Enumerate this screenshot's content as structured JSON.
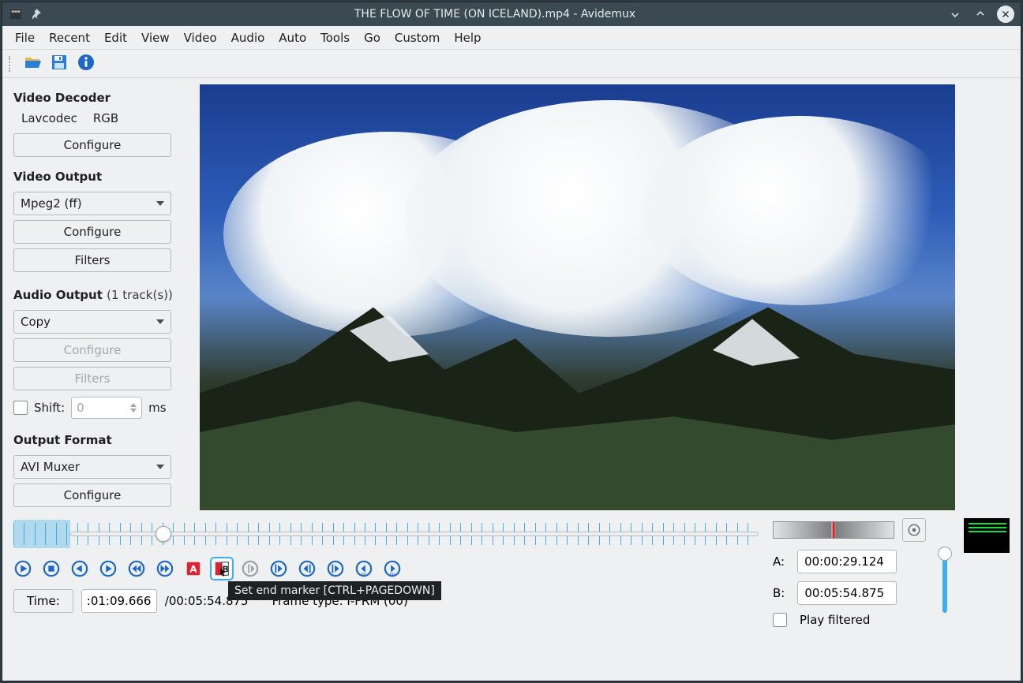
{
  "window": {
    "title": "THE FLOW OF TIME (ON ICELAND).mp4 - Avidemux"
  },
  "menu": {
    "file": "File",
    "recent": "Recent",
    "edit": "Edit",
    "view": "View",
    "video": "Video",
    "audio": "Audio",
    "auto": "Auto",
    "tools": "Tools",
    "go": "Go",
    "custom": "Custom",
    "help": "Help"
  },
  "sidebar": {
    "decoder": {
      "title": "Video Decoder",
      "codec": "Lavcodec",
      "colorspace": "RGB",
      "configure": "Configure"
    },
    "video_output": {
      "title": "Video Output",
      "selected": "Mpeg2 (ff)",
      "configure": "Configure",
      "filters": "Filters"
    },
    "audio_output": {
      "title": "Audio Output",
      "tracks": "(1 track(s))",
      "selected": "Copy",
      "configure": "Configure",
      "filters": "Filters",
      "shift_label": "Shift:",
      "shift_value": "0",
      "shift_unit": "ms"
    },
    "output_format": {
      "title": "Output Format",
      "selected": "AVI Muxer",
      "configure": "Configure"
    }
  },
  "tooltip": "Set end marker [CTRL+PAGEDOWN]",
  "time": {
    "label": "Time:",
    "current": ":01:09.666",
    "total": "/00:05:54.875",
    "frame_type": "Frame type: I-FRM (00)"
  },
  "markers": {
    "a_label": "A:",
    "a_value": "00:00:29.124",
    "b_label": "B:",
    "b_value": "00:05:54.875",
    "play_filtered": "Play filtered"
  }
}
